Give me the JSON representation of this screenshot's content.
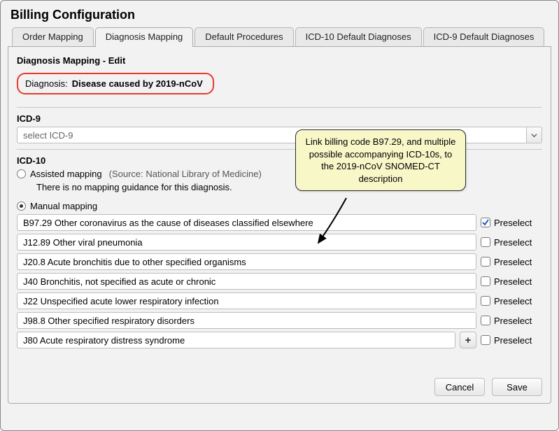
{
  "window_title": "Billing Configuration",
  "tabs": [
    {
      "id": "order-mapping",
      "label": "Order Mapping"
    },
    {
      "id": "diagnosis-mapping",
      "label": "Diagnosis Mapping"
    },
    {
      "id": "default-procedures",
      "label": "Default Procedures"
    },
    {
      "id": "icd10-default",
      "label": "ICD-10 Default Diagnoses"
    },
    {
      "id": "icd9-default",
      "label": "ICD-9 Default Diagnoses"
    }
  ],
  "active_tab": "diagnosis-mapping",
  "panel": {
    "heading": "Diagnosis Mapping - Edit",
    "diagnosis_label": "Diagnosis:",
    "diagnosis_value": "Disease caused by 2019-nCoV",
    "icd9": {
      "section_label": "ICD-9",
      "placeholder": "select ICD-9"
    },
    "icd10": {
      "section_label": "ICD-10",
      "assisted": {
        "label": "Assisted mapping",
        "source": "(Source: National Library of Medicine)",
        "hint": "There is no mapping guidance for this diagnosis.",
        "selected": false
      },
      "manual": {
        "label": "Manual mapping",
        "selected": true,
        "rows": [
          {
            "value": "B97.29 Other coronavirus as the cause of diseases classified elsewhere",
            "preselect": true
          },
          {
            "value": "J12.89 Other viral pneumonia",
            "preselect": false
          },
          {
            "value": "J20.8 Acute bronchitis due to other specified organisms",
            "preselect": false
          },
          {
            "value": "J40 Bronchitis, not specified as acute or chronic",
            "preselect": false
          },
          {
            "value": "J22 Unspecified acute lower respiratory infection",
            "preselect": false
          },
          {
            "value": "J98.8 Other specified respiratory disorders",
            "preselect": false
          },
          {
            "value": "J80 Acute respiratory distress syndrome",
            "preselect": false
          }
        ],
        "preselect_label": "Preselect",
        "add_label": "+"
      }
    },
    "buttons": {
      "cancel": "Cancel",
      "save": "Save"
    }
  },
  "callout_text": "Link billing code B97.29, and multiple possible accompanying ICD-10s, to the 2019-nCoV SNOMED-CT description"
}
